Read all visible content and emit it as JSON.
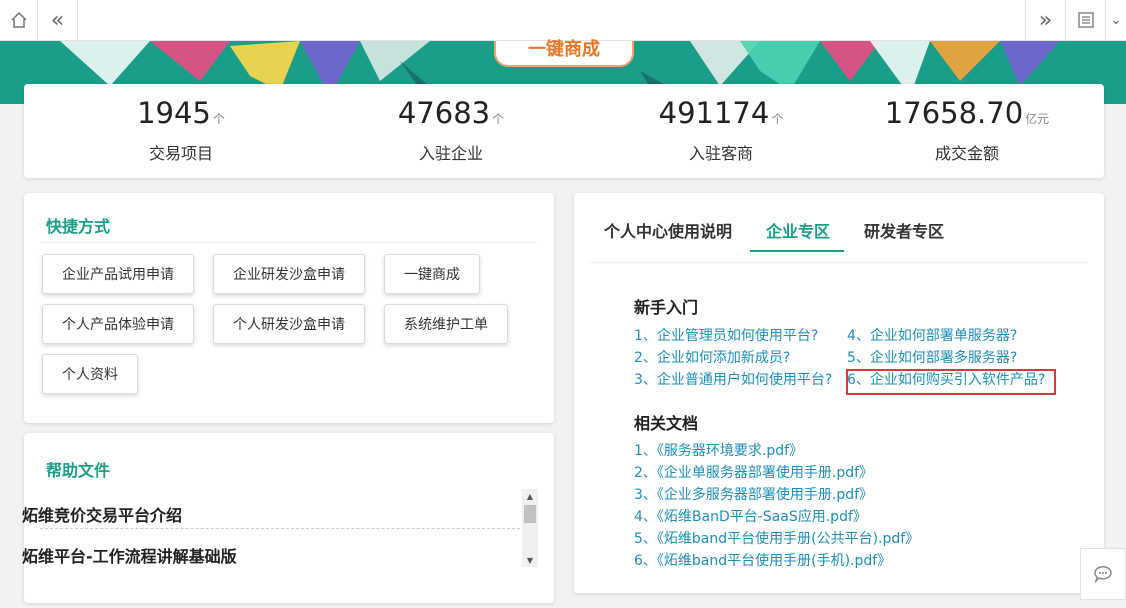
{
  "toolbar": {
    "home_icon": "home-icon",
    "back_icon": "double-chevron-left-icon",
    "forward_icon": "double-chevron-right-icon",
    "list_icon": "document-list-icon",
    "dropdown_icon": "chevron-down-icon"
  },
  "banner": {
    "button_label": "一键商成"
  },
  "stats": [
    {
      "value": "1945",
      "unit": "个",
      "label": "交易项目"
    },
    {
      "value": "47683",
      "unit": "个",
      "label": "入驻企业"
    },
    {
      "value": "491174",
      "unit": "个",
      "label": "入驻客商"
    },
    {
      "value": "17658.70",
      "unit": "亿元",
      "label": "成交金额"
    }
  ],
  "shortcuts": {
    "title": "快捷方式",
    "buttons": [
      "企业产品试用申请",
      "企业研发沙盒申请",
      "一键商成",
      "个人产品体验申请",
      "个人研发沙盒申请",
      "系统维护工单",
      "个人资料"
    ]
  },
  "help": {
    "title": "帮助文件",
    "items": [
      "炻维竞价交易平台介绍",
      "炻维平台-工作流程讲解基础版"
    ]
  },
  "tabs": [
    {
      "label": "个人中心使用说明",
      "active": false
    },
    {
      "label": "企业专区",
      "active": true
    },
    {
      "label": "研发者专区",
      "active": false
    }
  ],
  "getting_started": {
    "title": "新手入门",
    "links": [
      "1、企业管理员如何使用平台?",
      "2、企业如何添加新成员?",
      "3、企业普通用户如何使用平台?",
      "4、企业如何部署单服务器?",
      "5、企业如何部署多服务器?",
      "6、企业如何购买引入软件产品?"
    ]
  },
  "docs": {
    "title": "相关文档",
    "links": [
      "1、《服务器环境要求.pdf》",
      "2、《企业单服务器部署使用手册.pdf》",
      "3、《企业多服务器部署使用手册.pdf》",
      "4、《炻维BanD平台-SaaS应用.pdf》",
      "5、《炻维band平台使用手册(公共平台).pdf》",
      "6、《炻维band平台使用手册(手机).pdf》"
    ]
  },
  "colors": {
    "brand": "#1a9e87",
    "link": "#1d8fb8",
    "highlight": "#d9393c",
    "accent": "#e8792a"
  }
}
